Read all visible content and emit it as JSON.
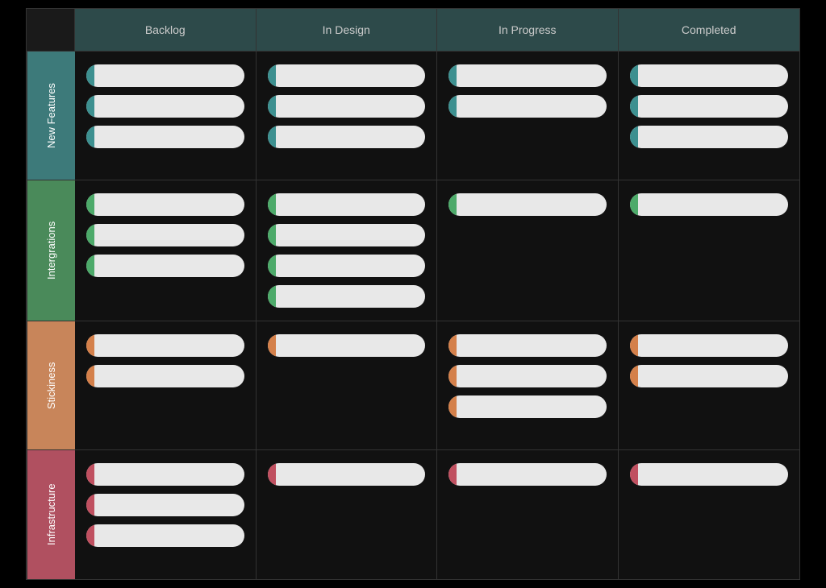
{
  "header": {
    "corner_label": "",
    "columns": [
      "Backlog",
      "In Design",
      "In Progress",
      "Completed"
    ]
  },
  "rows": [
    {
      "id": "new-features",
      "label": "New Features",
      "label_class": "new-features",
      "accent_class": "accent-teal",
      "cells": [
        {
          "cards": 3
        },
        {
          "cards": 3
        },
        {
          "cards": 2
        },
        {
          "cards": 3
        }
      ]
    },
    {
      "id": "integrations",
      "label": "Intergrations",
      "label_class": "integrations",
      "accent_class": "accent-green",
      "cells": [
        {
          "cards": 3
        },
        {
          "cards": 4
        },
        {
          "cards": 1
        },
        {
          "cards": 1
        }
      ]
    },
    {
      "id": "stickiness",
      "label": "Stickiness",
      "label_class": "stickiness",
      "accent_class": "accent-orange",
      "cells": [
        {
          "cards": 2
        },
        {
          "cards": 1
        },
        {
          "cards": 3
        },
        {
          "cards": 2
        }
      ]
    },
    {
      "id": "infrastructure",
      "label": "Infrastructure",
      "label_class": "infrastructure",
      "accent_class": "accent-red",
      "cells": [
        {
          "cards": 3
        },
        {
          "cards": 1
        },
        {
          "cards": 1
        },
        {
          "cards": 1
        }
      ]
    }
  ]
}
